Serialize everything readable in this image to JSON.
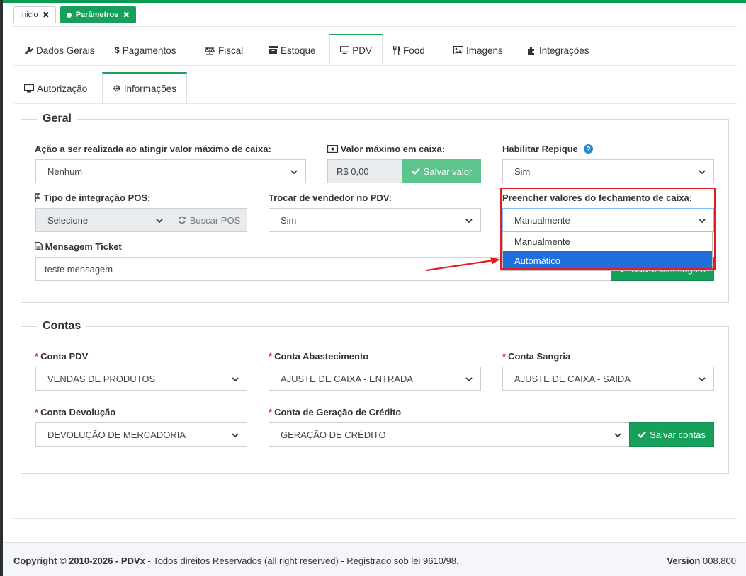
{
  "breadcrumbs": [
    {
      "label": "Inicio",
      "close": "✖"
    },
    {
      "label": "Parâmetros",
      "close": "✖"
    }
  ],
  "tabs_row1": [
    {
      "label": "Dados Gerais",
      "icon": "wrench-icon"
    },
    {
      "label": "Pagamentos",
      "icon": "dollar-icon"
    },
    {
      "label": "Fiscal",
      "icon": "balance-scale-icon"
    },
    {
      "label": "Estoque",
      "icon": "archive-icon"
    },
    {
      "label": "PDV",
      "icon": "desktop-icon"
    },
    {
      "label": "Food",
      "icon": "utensils-icon"
    },
    {
      "label": "Imagens",
      "icon": "image-icon"
    },
    {
      "label": "Integrações",
      "icon": "puzzle-icon"
    }
  ],
  "tabs_row2": [
    {
      "label": "Autorização",
      "icon": "desktop-icon"
    },
    {
      "label": "Informações",
      "icon": "gear-icon"
    }
  ],
  "geral": {
    "legend": "Geral",
    "acao_label": "Ação a ser realizada ao atingir valor máximo de caixa:",
    "acao_value": "Nenhum",
    "valor_max_label": "Valor máximo em caixa:",
    "valor_max_value": "R$ 0,00",
    "salvar_valor": "Salvar valor",
    "repique_label": "Habilitar Repique",
    "repique_value": "Sim",
    "tipo_pos_label": "Tipo de integração POS:",
    "tipo_pos_value": "Selecione",
    "buscar_pos": "Buscar POS",
    "trocar_vendedor_label": "Trocar de vendedor no PDV:",
    "trocar_vendedor_value": "Sim",
    "preencher_label": "Preencher valores do fechamento de caixa:",
    "preencher_value": "Manualmente",
    "preencher_options": [
      "Manualmente",
      "Automático"
    ],
    "mensagem_label": "Mensagem Ticket",
    "mensagem_value": "teste mensagem",
    "salvar_mensagem": "Salvar mensagem"
  },
  "contas": {
    "legend": "Contas",
    "required_mark": "*",
    "conta_pdv_label": "Conta PDV",
    "conta_pdv_value": "VENDAS DE PRODUTOS",
    "conta_abastecimento_label": "Conta Abastecimento",
    "conta_abastecimento_value": "AJUSTE DE CAIXA - ENTRADA",
    "conta_sangria_label": "Conta Sangria",
    "conta_sangria_value": "AJUSTE DE CAIXA - SAIDA",
    "conta_devolucao_label": "Conta Devolução",
    "conta_devolucao_value": "DEVOLUÇÃO DE MERCADORIA",
    "conta_credito_label": "Conta de Geração de Crédito",
    "conta_credito_value": "GERAÇÃO DE CRÉDITO",
    "salvar_contas": "Salvar contas"
  },
  "footer": {
    "copyright_bold": "Copyright © 2010-2026 - PDVx",
    "copyright_rest": " - Todos direitos Reservados (all right reserved) - Registrado sob lei 9610/98.",
    "version_label": "Version",
    "version_value": "008.800"
  },
  "colors": {
    "accent": "#16a05a",
    "highlight": "#1e6fd9",
    "annotation": "#e11c24"
  }
}
